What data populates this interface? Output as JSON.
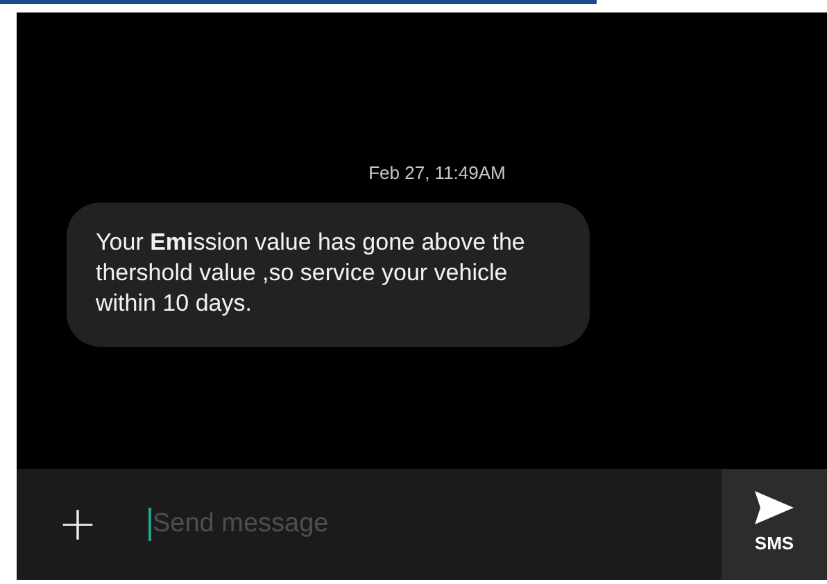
{
  "conversation": {
    "timestamp": "Feb 27, 11:49AM",
    "messages": [
      {
        "text": "Your **Emi**ssion value has gone above the thershold value ,so service your vehicle within 10 days.",
        "kind": "incoming"
      }
    ]
  },
  "composer": {
    "placeholder": "Send message",
    "attach_icon": "+",
    "send_label": "SMS"
  }
}
